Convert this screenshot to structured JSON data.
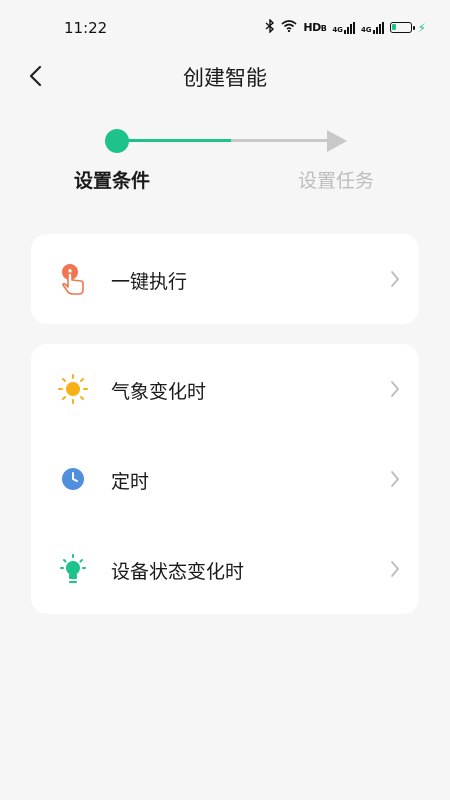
{
  "status_bar": {
    "time": "11:22",
    "network_label": "HD",
    "network_sub": "B",
    "signal1_label": "4G",
    "signal2_label": "4G",
    "battery_level": 0.25,
    "bluetooth_icon": "bluetooth-icon",
    "wifi_icon": "wifi-icon"
  },
  "header": {
    "title": "创建智能",
    "back_icon": "chevron-left-icon"
  },
  "stepper": {
    "steps": [
      {
        "label": "设置条件",
        "active": true
      },
      {
        "label": "设置任务",
        "active": false
      }
    ],
    "active_color": "#1ec28b",
    "inactive_color": "#c8c8c8"
  },
  "manual_card": {
    "items": [
      {
        "label": "一键执行",
        "icon": "tap-hand-icon",
        "icon_color": "#f0764f"
      }
    ]
  },
  "auto_card": {
    "items": [
      {
        "label": "气象变化时",
        "icon": "sun-icon",
        "icon_color": "#f5b117"
      },
      {
        "label": "定时",
        "icon": "clock-icon",
        "icon_color": "#4f8fdd"
      },
      {
        "label": "设备状态变化时",
        "icon": "bulb-icon",
        "icon_color": "#1ec28b"
      }
    ]
  }
}
